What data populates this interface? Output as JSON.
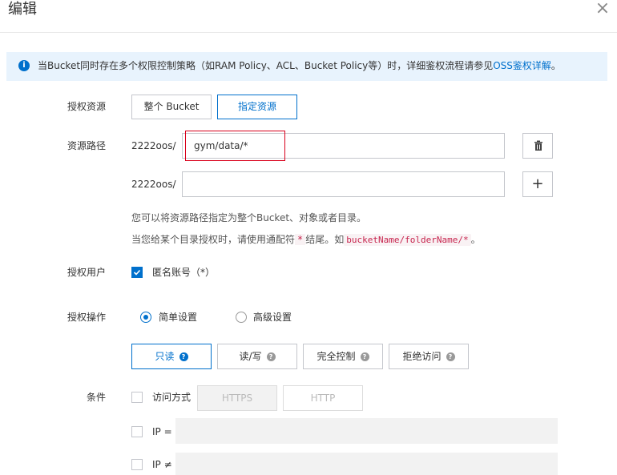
{
  "dialog": {
    "title": "编辑",
    "close_glyph": "×"
  },
  "notice": {
    "text": "当Bucket同时存在多个权限控制策略（如RAM Policy、ACL、Bucket Policy等）时，详细鉴权流程请参见",
    "link": "OSS鉴权详解",
    "suffix": "。",
    "icon": "info-icon"
  },
  "resource": {
    "label": "授权资源",
    "options": [
      "整个 Bucket",
      "指定资源"
    ],
    "selected": "指定资源"
  },
  "resource_path": {
    "label": "资源路径",
    "rows": [
      {
        "prefix": "2222oos/",
        "value": "gym/data/*",
        "action": "trash-icon"
      },
      {
        "prefix": "2222oos/",
        "value": "",
        "action": "plus-icon"
      }
    ],
    "hint1": "您可以将资源路径指定为整个Bucket、对象或者目录。",
    "hint2_a": "当您给某个目录授权时，请使用通配符",
    "hint2_star": "*",
    "hint2_b": "结尾。如",
    "hint2_code": "bucketName/folderName/*",
    "hint2_c": "。"
  },
  "user": {
    "label": "授权用户",
    "checkbox_label": "匿名账号（*）",
    "checked": true
  },
  "operation": {
    "label": "授权操作",
    "modes": [
      "简单设置",
      "高级设置"
    ],
    "selected_mode": "简单设置",
    "permissions": [
      "只读",
      "读/写",
      "完全控制",
      "拒绝访问"
    ],
    "selected_permission": "只读"
  },
  "conditions": {
    "label": "条件",
    "access_method_label": "访问方式",
    "protocols": [
      "HTTPS",
      "HTTP"
    ],
    "ip_eq_label": "IP =",
    "ip_neq_label": "IP ≠"
  },
  "colors": {
    "accent": "#0070cc",
    "highlight": "#d9001b",
    "notice_bg": "#e8f3fd"
  }
}
